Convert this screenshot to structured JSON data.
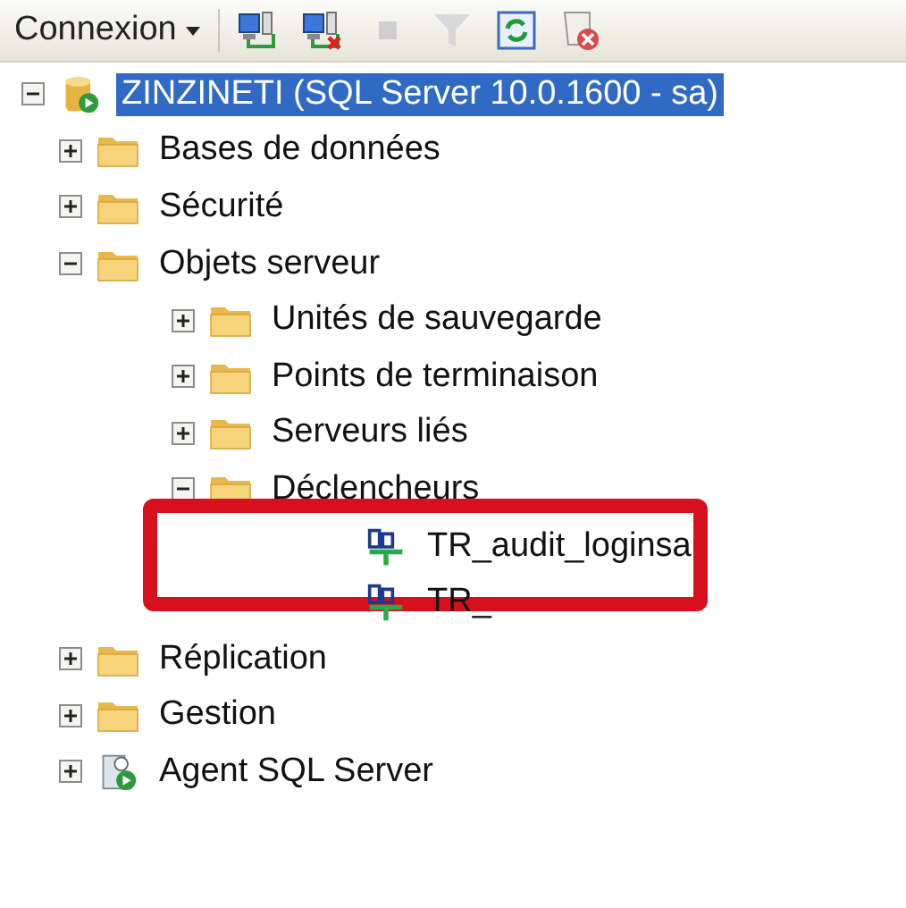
{
  "toolbar": {
    "connect_label": "Connexion",
    "buttons": [
      {
        "kind": "connect",
        "disabled": false
      },
      {
        "kind": "disconnect",
        "disabled": false
      },
      {
        "kind": "stop",
        "disabled": true
      },
      {
        "kind": "filter",
        "disabled": true
      },
      {
        "kind": "refresh",
        "disabled": false
      },
      {
        "kind": "script",
        "disabled": false
      }
    ]
  },
  "tree": [
    {
      "label": "ZINZINETI (SQL Server 10.0.1600 - sa)",
      "kind": "server",
      "expanded": true,
      "selected": true,
      "children": [
        {
          "label": "Bases de données",
          "kind": "folder",
          "expanded": false,
          "selected": false
        },
        {
          "label": "Sécurité",
          "kind": "folder",
          "expanded": false,
          "selected": false
        },
        {
          "label": "Objets serveur",
          "kind": "folder",
          "expanded": true,
          "selected": false,
          "children": [
            {
              "label": "Unités de sauvegarde",
              "kind": "folder",
              "expanded": false,
              "selected": false
            },
            {
              "label": "Points de terminaison",
              "kind": "folder",
              "expanded": false,
              "selected": false
            },
            {
              "label": "Serveurs liés",
              "kind": "folder",
              "expanded": false,
              "selected": false
            },
            {
              "label": "Déclencheurs",
              "kind": "folder",
              "expanded": true,
              "selected": false,
              "children": [
                {
                  "label": "TR_audit_loginsa",
                  "kind": "trigger",
                  "selected": false,
                  "highlighted": true
                },
                {
                  "label": "TR_",
                  "kind": "trigger",
                  "selected": false,
                  "highlighted": false
                }
              ]
            }
          ]
        },
        {
          "label": "Réplication",
          "kind": "folder",
          "expanded": false,
          "selected": false
        },
        {
          "label": "Gestion",
          "kind": "folder",
          "expanded": false,
          "selected": false
        },
        {
          "label": "Agent SQL Server",
          "kind": "agent",
          "expanded": false,
          "selected": false
        }
      ]
    }
  ]
}
